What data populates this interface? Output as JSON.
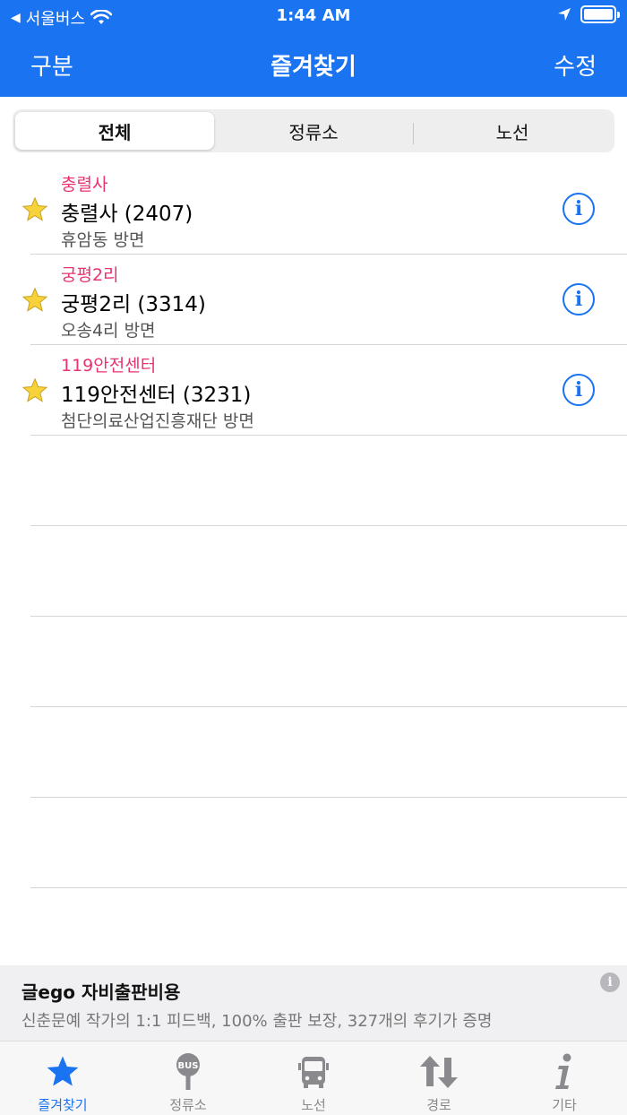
{
  "status_bar": {
    "carrier": "서울버스",
    "time": "1:44 AM"
  },
  "nav": {
    "left": "구분",
    "title": "즐겨찾기",
    "right": "수정"
  },
  "segments": [
    {
      "label": "전체",
      "active": true
    },
    {
      "label": "정류소",
      "active": false
    },
    {
      "label": "노선",
      "active": false
    }
  ],
  "favorites": [
    {
      "category": "충렬사",
      "name": "충렬사 (2407)",
      "direction": "휴암동 방면"
    },
    {
      "category": "궁평2리",
      "name": "궁평2리 (3314)",
      "direction": "오송4리 방면"
    },
    {
      "category": "119안전센터",
      "name": "119안전센터 (3231)",
      "direction": "첨단의료산업진흥재단 방면"
    }
  ],
  "ad": {
    "title": "글ego 자비출판비용",
    "description": "신춘문예 작가의 1:1 피드백, 100% 출판 보장, 327개의 후기가 증명"
  },
  "tabs": [
    {
      "label": "즐겨찾기",
      "icon": "star-icon",
      "active": true
    },
    {
      "label": "정류소",
      "icon": "bus-stop-icon",
      "active": false
    },
    {
      "label": "노선",
      "icon": "bus-icon",
      "active": false
    },
    {
      "label": "경로",
      "icon": "route-arrows-icon",
      "active": false
    },
    {
      "label": "기타",
      "icon": "info-icon",
      "active": false
    }
  ],
  "colors": {
    "accent": "#1a73f0",
    "category": "#e8336e",
    "star": "#f7d23a"
  }
}
